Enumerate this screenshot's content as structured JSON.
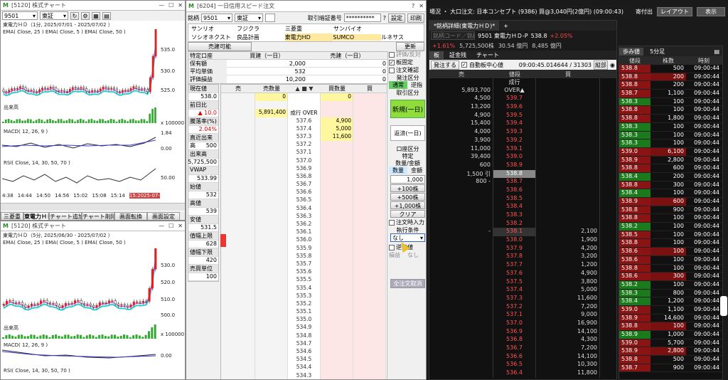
{
  "chart1": {
    "title": "[5120] 株式チャート",
    "code": "9501",
    "market": "東証",
    "name": "東電力ＨＤ（1分, 2025/07/01 - 2025/07/02 ）",
    "ema": "EMA( Close, 25 )  EMA( Close, 5 )  EMA( Close, 50 )",
    "y_ticks": [
      "535.0",
      "530.0",
      "525.0"
    ],
    "vol_label": "出来高",
    "vol_unit": "x 100000",
    "macd": "MACD( 12, 26, 9 )",
    "macd_ticks": [
      "1.84",
      "0.00"
    ],
    "rsi": "RSI( Close, 14, 30, 50, 70 )",
    "rsi_ticks": [
      "50.00"
    ],
    "x_ticks": [
      "4:38",
      "14:44",
      "14:50",
      "14:56",
      "15:02",
      "15:08",
      "15:14",
      "15:2025-07-"
    ],
    "bottom_tabs": [
      "三菱重",
      "東電力ＨＤ",
      "チャート追加",
      "チャート削除",
      "画面転換",
      "画面設定"
    ]
  },
  "chart2": {
    "title": "[5120] 株式チャート",
    "name": "東電力ＨＤ（5分, 2025/06/30 - 2025/07/02 ）",
    "ema": "EMA( Close, 25 )  EMA( Close, 5 )  EMA( Close, 50 )",
    "y_ticks": [
      "530.0",
      "520.0",
      "510.0",
      "500.0"
    ],
    "vol_label": "出来高",
    "vol_unit": "x 100000",
    "macd": "MACD( 12, 26, 9 )",
    "macd_ticks": [
      "0.00"
    ],
    "rsi": "RSI( Close, 14, 30, 50, 70 )"
  },
  "speed": {
    "title": "[6204] 一日信用スピード注文",
    "code_label": "銘柄",
    "code": "9501",
    "market": "東証",
    "pin_label": "取引暗証番号",
    "pin": "**********",
    "settings": "設定",
    "print": "印刷",
    "stocks": [
      [
        "サンリオ",
        "フジクラ",
        "三菱重",
        "サンバイオ"
      ],
      [
        "ソシオネクスト",
        "良品計画",
        "東電力HD",
        "SUMCO",
        "ルネサス"
      ]
    ],
    "sell_avail": "売建可能",
    "update": "更新",
    "pos_headers": [
      "特定口座",
      "買建（一日）",
      "売建（一日）"
    ],
    "pos_rows": [
      [
        "保有額",
        "2,000",
        "0"
      ],
      [
        "平均単価",
        "532",
        "0"
      ],
      [
        "評価損益",
        "10,200",
        "0"
      ]
    ],
    "left_labels": [
      [
        "現在値",
        ""
      ],
      [
        "538.0",
        ""
      ],
      [
        "前日比",
        ""
      ],
      [
        "▲ 10.0",
        ""
      ],
      [
        "騰落率(%)",
        ""
      ],
      [
        "2.04%",
        ""
      ],
      [
        "直近出来高",
        ""
      ],
      [
        "500",
        ""
      ],
      [
        "出来高",
        ""
      ],
      [
        "5,725,500",
        ""
      ],
      [
        "VWAP",
        ""
      ],
      [
        "533.99",
        ""
      ],
      [
        "始値",
        ""
      ],
      [
        "532",
        ""
      ],
      [
        "高値",
        ""
      ],
      [
        "539",
        ""
      ],
      [
        "安値",
        ""
      ],
      [
        "531.5",
        ""
      ],
      [
        "值幅上限",
        ""
      ],
      [
        "628",
        ""
      ],
      [
        "値幅下限",
        ""
      ],
      [
        "420",
        ""
      ],
      [
        "売買単位",
        ""
      ],
      [
        "100",
        ""
      ]
    ],
    "grid_headers": [
      "売",
      "売数量",
      "",
      "買数量",
      "買"
    ],
    "grid_rows": [
      [
        "",
        "0",
        "",
        "0",
        ""
      ],
      [
        "",
        "",
        "",
        "",
        " "
      ],
      [
        "",
        "5,891,400",
        "成行 OVER",
        "",
        ""
      ],
      [
        "",
        "",
        "537.6",
        "4,900",
        ""
      ],
      [
        "",
        "",
        "537.4",
        "5,000",
        ""
      ],
      [
        "",
        "",
        "537.3",
        "11,600",
        ""
      ],
      [
        "",
        "",
        "537.2",
        "",
        ""
      ],
      [
        "",
        "",
        "537.1",
        "",
        ""
      ],
      [
        "",
        "",
        "537.0",
        "",
        ""
      ],
      [
        "",
        "",
        "536.9",
        "",
        ""
      ],
      [
        "",
        "",
        "536.8",
        "",
        ""
      ],
      [
        "",
        "",
        "536.7",
        "",
        ""
      ],
      [
        "",
        "",
        "536.6",
        "",
        ""
      ],
      [
        "",
        "",
        "536.5",
        "",
        ""
      ],
      [
        "",
        "",
        "536.4",
        "",
        ""
      ],
      [
        "",
        "",
        "536.3",
        "",
        ""
      ],
      [
        "",
        "",
        "536.2",
        "",
        ""
      ],
      [
        "",
        "",
        "536.1",
        "",
        ""
      ],
      [
        "",
        "",
        "536.0",
        "",
        ""
      ],
      [
        "",
        "",
        "535.9",
        "",
        ""
      ],
      [
        "",
        "",
        "535.8",
        "",
        ""
      ],
      [
        "",
        "",
        "535.7",
        "",
        ""
      ],
      [
        "",
        "",
        "535.6",
        "",
        ""
      ],
      [
        "",
        "",
        "535.5",
        "",
        ""
      ],
      [
        "",
        "",
        "535.4",
        "",
        ""
      ],
      [
        "",
        "",
        "535.3",
        "",
        ""
      ],
      [
        "",
        "",
        "535.2",
        "",
        ""
      ],
      [
        "",
        "",
        "535.1",
        "",
        ""
      ],
      [
        "",
        "",
        "535.0",
        "",
        ""
      ],
      [
        "",
        "",
        "534.9",
        "",
        ""
      ],
      [
        "",
        "",
        "534.8",
        "",
        ""
      ],
      [
        "",
        "",
        "534.7",
        "",
        ""
      ],
      [
        "",
        "",
        "534.6",
        "",
        ""
      ],
      [
        "",
        "",
        "534.5",
        "",
        ""
      ],
      [
        "",
        "",
        "534.4",
        "",
        ""
      ],
      [
        "",
        "",
        "534.3",
        "",
        ""
      ]
    ],
    "right": {
      "c1": "評価/反対",
      "c2": "板固定",
      "c3": "注文確認",
      "c4": "発注区分",
      "c4a": "通常",
      "c4b": "逆指",
      "c5": "取引区分",
      "new": "新規(一日)",
      "close": "返済(一日)",
      "c6": "口座区分",
      "c6v": "特定",
      "c7": "数量/金額",
      "qty": "数量",
      "amt": "金額",
      "qval": "1,000",
      "b1": "+100株",
      "b2": "+500株",
      "b3": "+1,000株",
      "clear": "クリア",
      "c8": "注文時入力",
      "c9": "執行条件",
      "c9v": "なし",
      "c10": "逆指値",
      "c11": "損益",
      "none": "なし",
      "cancel": "全注文取消"
    }
  },
  "topbar": {
    "text": "場況 ・ 大口注文: 日本コンセプト (9386) 買@3,040円(2億円) (09:00:43)",
    "tag": "寄付出",
    "layout": "レイアウト",
    "display": "表示"
  },
  "board": {
    "tab": "*銘柄詳細(東電力ＨＤ)*",
    "search_ph": "銘柄コード／銘柄名",
    "stock": "9501 東電力ＨＤ-P",
    "price": "538.8",
    "chg": "+2.05%",
    "chg2": "+1.61%",
    "vol": "5,725,500株",
    "val": "30.54 億円",
    "cap": "8,485 億円",
    "tabs": [
      "板",
      "証金残",
      "チャート"
    ],
    "order": "発注する",
    "auto": "自動板中心値",
    "time": "09:00:45.014644 / 31303",
    "tate": "縦部",
    "headers": [
      "売",
      "値段",
      "買"
    ],
    "rows": [
      [
        "",
        "成行",
        ""
      ],
      [
        "5,893,700",
        "OVER▲",
        ""
      ],
      [
        "4,500",
        "539.7",
        ""
      ],
      [
        "13,200",
        "539.6",
        ""
      ],
      [
        "4,900",
        "539.5",
        ""
      ],
      [
        "15,400",
        "539.4",
        ""
      ],
      [
        "4,000",
        "539.3",
        ""
      ],
      [
        "3,900",
        "539.2",
        ""
      ],
      [
        "11,000",
        "539.1",
        ""
      ],
      [
        "39,400",
        "539.0",
        ""
      ],
      [
        "600",
        "538.9",
        ""
      ],
      [
        "1,500 引",
        "538.8",
        ""
      ],
      [
        "800 -",
        "538.7",
        ""
      ],
      [
        "",
        "538.6",
        ""
      ],
      [
        "",
        "538.5",
        ""
      ],
      [
        "",
        "538.4",
        ""
      ],
      [
        "",
        "538.3",
        ""
      ],
      [
        "",
        "538.2",
        ""
      ],
      [
        "-",
        "538.1",
        "2,100"
      ],
      [
        "",
        "538.0",
        "1,900"
      ],
      [
        "",
        "537.9",
        "4,200"
      ],
      [
        "",
        "537.8",
        "3,200"
      ],
      [
        "",
        "537.7",
        "1,200"
      ],
      [
        "",
        "537.6",
        "4,900"
      ],
      [
        "",
        "537.5",
        "3,800"
      ],
      [
        "",
        "537.4",
        "5,000"
      ],
      [
        "",
        "537.3",
        "11,600"
      ],
      [
        "",
        "537.2",
        "7,200"
      ],
      [
        "",
        "537.1",
        "9,000"
      ],
      [
        "",
        "537.0",
        "16,900"
      ],
      [
        "",
        "536.9",
        "14,100"
      ],
      [
        "",
        "536.8",
        "4,300"
      ],
      [
        "",
        "536.7",
        "7,200"
      ],
      [
        "",
        "536.6",
        "14,100"
      ],
      [
        "",
        "536.5",
        "10,300"
      ],
      [
        "",
        "536.4",
        "11,800"
      ]
    ]
  },
  "tape": {
    "tabs": [
      "歩み値",
      "5分足"
    ],
    "headers": [
      "値段",
      "株数",
      "時刻"
    ],
    "rows": [
      [
        "538.8",
        "500",
        "09:00:44",
        "r"
      ],
      [
        "538.8",
        "200",
        "09:00:44",
        "r"
      ],
      [
        "538.8",
        "200",
        "09:00:44",
        "r"
      ],
      [
        "538.7",
        "1,100",
        "09:00:44",
        "r"
      ],
      [
        "538.3",
        "100",
        "09:00:44",
        "g"
      ],
      [
        "538.8",
        "100",
        "09:00:44",
        "r"
      ],
      [
        "538.8",
        "1,800",
        "09:00:44",
        "r"
      ],
      [
        "538.3",
        "100",
        "09:00:44",
        "g"
      ],
      [
        "538.3",
        "100",
        "09:00:44",
        "g"
      ],
      [
        "538.3",
        "100",
        "09:00:44",
        "g"
      ],
      [
        "539.0",
        "6,100",
        "09:00:44",
        "r"
      ],
      [
        "538.9",
        "2,800",
        "09:00:44",
        "r"
      ],
      [
        "538.8",
        "600",
        "09:00:44",
        "r"
      ],
      [
        "538.4",
        "200",
        "09:00:44",
        "g"
      ],
      [
        "538.8",
        "300",
        "09:00:44",
        "r"
      ],
      [
        "538.4",
        "100",
        "09:00:44",
        "g"
      ],
      [
        "538.9",
        "600",
        "09:00:44",
        "r"
      ],
      [
        "538.8",
        "900",
        "09:00:44",
        "r"
      ],
      [
        "538.8",
        "100",
        "09:00:44",
        "r"
      ],
      [
        "538.2",
        "100",
        "09:00:44",
        "g"
      ],
      [
        "538.5",
        "100",
        "09:00:44",
        "r"
      ],
      [
        "538.8",
        "100",
        "09:00:44",
        "r"
      ],
      [
        "538.6",
        "100",
        "09:00:44",
        "r"
      ],
      [
        "538.6",
        "100",
        "09:00:44",
        "r"
      ],
      [
        "538.8",
        "100",
        "09:00:44",
        "r"
      ],
      [
        "538.6",
        "300",
        "09:00:44",
        "r"
      ],
      [
        "538.2",
        "100",
        "09:00:44",
        "g"
      ],
      [
        "538.3",
        "800",
        "09:00:44",
        "g"
      ],
      [
        "538.4",
        "1,200",
        "09:00:44",
        "g"
      ],
      [
        "539.0",
        "1,100",
        "09:00:44",
        "r"
      ],
      [
        "538.9",
        "14,600",
        "09:00:44",
        "r"
      ],
      [
        "538.8",
        "100",
        "09:00:44",
        "r"
      ],
      [
        "538.9",
        "1,000",
        "09:00:44",
        "g"
      ],
      [
        "539.0",
        "5,700",
        "09:00:44",
        "r"
      ],
      [
        "538.9",
        "2,800",
        "09:00:44",
        "r"
      ],
      [
        "538.8",
        "500",
        "09:00:44",
        "r"
      ],
      [
        "538.7",
        "900",
        "09:00:44",
        "r"
      ]
    ]
  }
}
